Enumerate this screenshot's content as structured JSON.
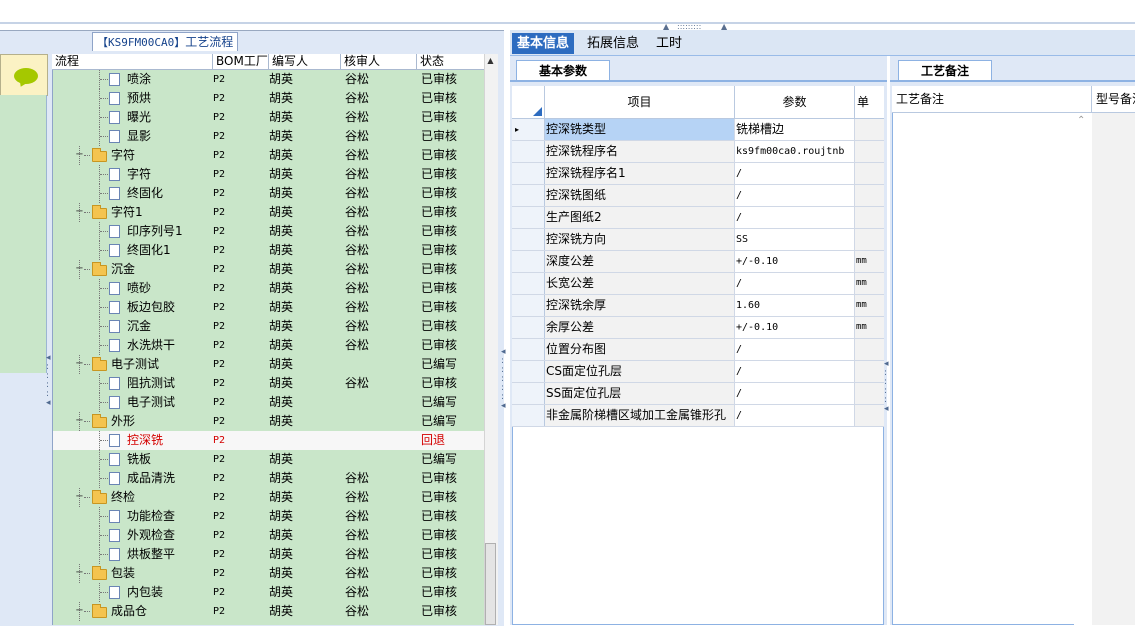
{
  "left_panel": {
    "title_code": "【KS9FM00CA0】",
    "title_text": "工艺流程",
    "columns": [
      "流程",
      "BOM工厂",
      "编写人",
      "核审人",
      "状态"
    ],
    "rows": [
      {
        "name": "喷涂",
        "level": 2,
        "type": "doc",
        "bom": "P2",
        "editor": "胡英",
        "reviewer": "谷松",
        "status": "已审核"
      },
      {
        "name": "预烘",
        "level": 2,
        "type": "doc",
        "bom": "P2",
        "editor": "胡英",
        "reviewer": "谷松",
        "status": "已审核"
      },
      {
        "name": "曝光",
        "level": 2,
        "type": "doc",
        "bom": "P2",
        "editor": "胡英",
        "reviewer": "谷松",
        "status": "已审核"
      },
      {
        "name": "显影",
        "level": 2,
        "type": "doc",
        "bom": "P2",
        "editor": "胡英",
        "reviewer": "谷松",
        "status": "已审核"
      },
      {
        "name": "字符",
        "level": 1,
        "type": "folder",
        "bom": "P2",
        "editor": "胡英",
        "reviewer": "谷松",
        "status": "已审核"
      },
      {
        "name": "字符",
        "level": 2,
        "type": "doc",
        "bom": "P2",
        "editor": "胡英",
        "reviewer": "谷松",
        "status": "已审核"
      },
      {
        "name": "终固化",
        "level": 2,
        "type": "doc",
        "bom": "P2",
        "editor": "胡英",
        "reviewer": "谷松",
        "status": "已审核"
      },
      {
        "name": "字符1",
        "level": 1,
        "type": "folder",
        "bom": "P2",
        "editor": "胡英",
        "reviewer": "谷松",
        "status": "已审核"
      },
      {
        "name": "印序列号1",
        "level": 2,
        "type": "doc",
        "bom": "P2",
        "editor": "胡英",
        "reviewer": "谷松",
        "status": "已审核"
      },
      {
        "name": "终固化1",
        "level": 2,
        "type": "doc",
        "bom": "P2",
        "editor": "胡英",
        "reviewer": "谷松",
        "status": "已审核"
      },
      {
        "name": "沉金",
        "level": 1,
        "type": "folder",
        "bom": "P2",
        "editor": "胡英",
        "reviewer": "谷松",
        "status": "已审核"
      },
      {
        "name": "喷砂",
        "level": 2,
        "type": "doc",
        "bom": "P2",
        "editor": "胡英",
        "reviewer": "谷松",
        "status": "已审核"
      },
      {
        "name": "板边包胶",
        "level": 2,
        "type": "doc",
        "bom": "P2",
        "editor": "胡英",
        "reviewer": "谷松",
        "status": "已审核"
      },
      {
        "name": "沉金",
        "level": 2,
        "type": "doc",
        "bom": "P2",
        "editor": "胡英",
        "reviewer": "谷松",
        "status": "已审核"
      },
      {
        "name": "水洗烘干",
        "level": 2,
        "type": "doc",
        "bom": "P2",
        "editor": "胡英",
        "reviewer": "谷松",
        "status": "已审核"
      },
      {
        "name": "电子测试",
        "level": 1,
        "type": "folder",
        "bom": "P2",
        "editor": "胡英",
        "reviewer": "",
        "status": "已编写"
      },
      {
        "name": "阻抗测试",
        "level": 2,
        "type": "doc",
        "bom": "P2",
        "editor": "胡英",
        "reviewer": "谷松",
        "status": "已审核"
      },
      {
        "name": "电子测试",
        "level": 2,
        "type": "doc",
        "bom": "P2",
        "editor": "胡英",
        "reviewer": "",
        "status": "已编写"
      },
      {
        "name": "外形",
        "level": 1,
        "type": "folder",
        "bom": "P2",
        "editor": "胡英",
        "reviewer": "",
        "status": "已编写"
      },
      {
        "name": "控深铣",
        "level": 2,
        "type": "doc",
        "bom": "P2",
        "editor": "",
        "reviewer": "",
        "status": "回退",
        "highlight": true
      },
      {
        "name": "铣板",
        "level": 2,
        "type": "doc",
        "bom": "P2",
        "editor": "胡英",
        "reviewer": "",
        "status": "已编写"
      },
      {
        "name": "成品清洗",
        "level": 2,
        "type": "doc",
        "bom": "P2",
        "editor": "胡英",
        "reviewer": "谷松",
        "status": "已审核"
      },
      {
        "name": "终检",
        "level": 1,
        "type": "folder",
        "bom": "P2",
        "editor": "胡英",
        "reviewer": "谷松",
        "status": "已审核"
      },
      {
        "name": "功能检查",
        "level": 2,
        "type": "doc",
        "bom": "P2",
        "editor": "胡英",
        "reviewer": "谷松",
        "status": "已审核"
      },
      {
        "name": "外观检查",
        "level": 2,
        "type": "doc",
        "bom": "P2",
        "editor": "胡英",
        "reviewer": "谷松",
        "status": "已审核"
      },
      {
        "name": "烘板整平",
        "level": 2,
        "type": "doc",
        "bom": "P2",
        "editor": "胡英",
        "reviewer": "谷松",
        "status": "已审核"
      },
      {
        "name": "包装",
        "level": 1,
        "type": "folder",
        "bom": "P2",
        "editor": "胡英",
        "reviewer": "谷松",
        "status": "已审核"
      },
      {
        "name": "内包装",
        "level": 2,
        "type": "doc",
        "bom": "P2",
        "editor": "胡英",
        "reviewer": "谷松",
        "status": "已审核"
      },
      {
        "name": "成品仓",
        "level": 1,
        "type": "folder",
        "bom": "P2",
        "editor": "胡英",
        "reviewer": "谷松",
        "status": "已审核"
      }
    ]
  },
  "top_tabs": [
    "基本信息",
    "拓展信息",
    "工时"
  ],
  "basic_panel": {
    "tab_label": "基本参数",
    "columns": {
      "item": "项目",
      "param": "参数",
      "unit": "单"
    },
    "rows": [
      {
        "item": "控深铣类型",
        "value": "铣梯槽边",
        "unit": "",
        "active": true
      },
      {
        "item": "控深铣程序名",
        "value": "ks9fm00ca0.roujtnb",
        "unit": ""
      },
      {
        "item": "控深铣程序名1",
        "value": "/",
        "unit": ""
      },
      {
        "item": "控深铣图纸",
        "value": "/",
        "unit": ""
      },
      {
        "item": "生产图纸2",
        "value": "/",
        "unit": ""
      },
      {
        "item": "控深铣方向",
        "value": "SS",
        "unit": ""
      },
      {
        "item": "深度公差",
        "value": "+/-0.10",
        "unit": "mm"
      },
      {
        "item": "长宽公差",
        "value": "/",
        "unit": "mm"
      },
      {
        "item": "控深铣余厚",
        "value": "1.60",
        "unit": "mm"
      },
      {
        "item": "余厚公差",
        "value": "+/-0.10",
        "unit": "mm"
      },
      {
        "item": "位置分布图",
        "value": "/",
        "unit": ""
      },
      {
        "item": "CS面定位孔层",
        "value": "/",
        "unit": ""
      },
      {
        "item": "SS面定位孔层",
        "value": "/",
        "unit": ""
      },
      {
        "item": "非金属阶梯槽区域加工金属锥形孔",
        "value": "/",
        "unit": ""
      }
    ]
  },
  "remark_panel": {
    "tab_label": "工艺备注",
    "columns": [
      "工艺备注",
      "型号备注"
    ]
  },
  "colors": {
    "accent": "#2d6cc0",
    "tree_bg": "#c9e6c9",
    "panel_bg": "#dfe8f6",
    "returned": "#d40000"
  }
}
